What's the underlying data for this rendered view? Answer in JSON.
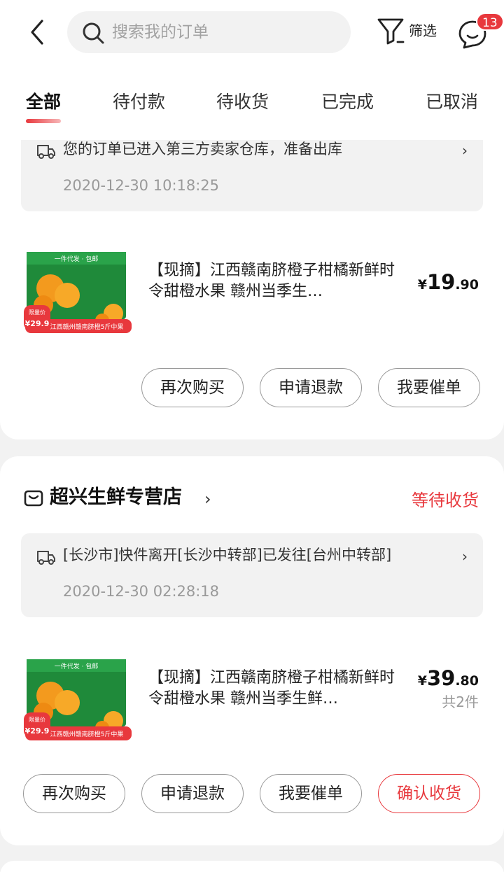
{
  "search": {
    "placeholder": "搜索我的订单"
  },
  "header": {
    "filter_label": "筛选",
    "message_badge": "13"
  },
  "tabs": [
    "全部",
    "待付款",
    "待收货",
    "已完成",
    "已取消"
  ],
  "orders": [
    {
      "logistics_text": "您的订单已进入第三方卖家仓库，准备出库",
      "logistics_time": "2020-12-30 10:18:25",
      "product_title": "【现摘】江西赣南脐橙子柑橘新鲜时令甜橙水果 赣州当季生…",
      "price_yen": "¥",
      "price_int": "19",
      "price_dec": ".90",
      "buttons": [
        "再次购买",
        "申请退款",
        "我要催单"
      ],
      "image_text": {
        "promo": "限量价",
        "price": "¥29.9",
        "caption": "江西赣州赣南脐橙5斤中果",
        "top": "一件代发 · 包邮"
      }
    },
    {
      "shop_name": "超兴生鲜专营店",
      "status": "等待收货",
      "logistics_text": "[长沙市]快件离开[长沙中转部]已发往[台州中转部]",
      "logistics_time": "2020-12-30 02:28:18",
      "product_title": "【现摘】江西赣南脐橙子柑橘新鲜时令甜橙水果 赣州当季生鲜…",
      "price_yen": "¥",
      "price_int": "39",
      "price_dec": ".80",
      "quantity": "共2件",
      "buttons": [
        "再次购买",
        "申请退款",
        "我要催单",
        "确认收货"
      ],
      "image_text": {
        "promo": "限量价",
        "price": "¥29.9",
        "caption": "江西赣州赣南脐橙5斤中果",
        "top": "一件代发 · 包邮"
      }
    }
  ],
  "colors": {
    "accent": "#e8383d",
    "background": "#f2f2f2",
    "muted": "#999999"
  },
  "icons": [
    "back-icon",
    "search-icon",
    "filter-icon",
    "message-icon",
    "truck-icon",
    "shop-icon",
    "chevron-right-icon"
  ]
}
